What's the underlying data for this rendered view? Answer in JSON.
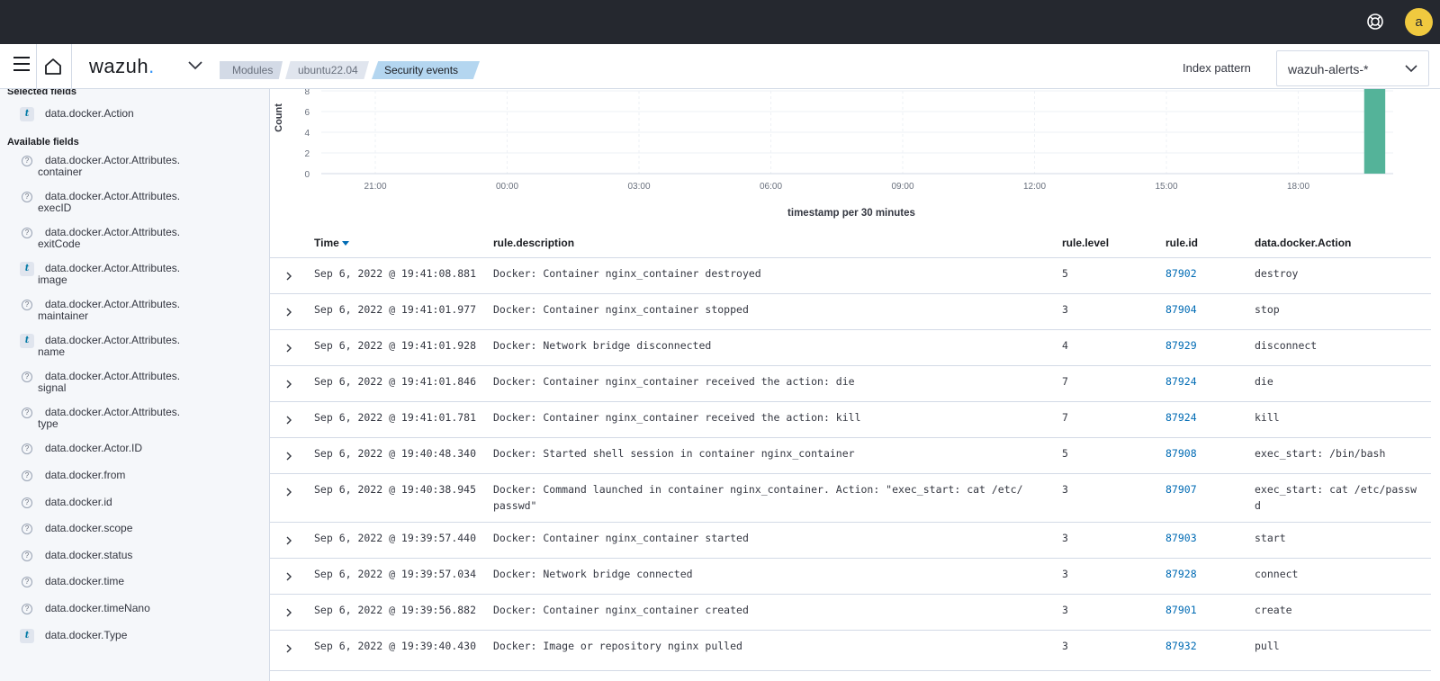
{
  "topbar": {
    "avatar_initial": "a"
  },
  "navbar": {
    "logo_text": "wazuh",
    "logo_dot": ".",
    "breadcrumbs": [
      "Modules",
      "ubuntu22.04",
      "Security events"
    ],
    "info_glyph": "i",
    "index_pattern_label": "Index pattern",
    "index_pattern_value": "wazuh-alerts-*"
  },
  "sidebar": {
    "selected_heading": "Selected fields",
    "selected_fields": [
      {
        "type": "t",
        "name": "data.docker.Action"
      }
    ],
    "available_heading": "Available fields",
    "available_fields": [
      {
        "type": "?",
        "name": "data.docker.Actor.Attributes.",
        "name2": "container"
      },
      {
        "type": "?",
        "name": "data.docker.Actor.Attributes.",
        "name2": "execID"
      },
      {
        "type": "?",
        "name": "data.docker.Actor.Attributes.",
        "name2": "exitCode"
      },
      {
        "type": "t",
        "name": "data.docker.Actor.Attributes.",
        "name2": "image"
      },
      {
        "type": "?",
        "name": "data.docker.Actor.Attributes.",
        "name2": "maintainer"
      },
      {
        "type": "t",
        "name": "data.docker.Actor.Attributes.",
        "name2": "name"
      },
      {
        "type": "?",
        "name": "data.docker.Actor.Attributes.",
        "name2": "signal"
      },
      {
        "type": "?",
        "name": "data.docker.Actor.Attributes.",
        "name2": "type"
      },
      {
        "type": "?",
        "name": "data.docker.Actor.ID",
        "name2": ""
      },
      {
        "type": "?",
        "name": "data.docker.from",
        "name2": ""
      },
      {
        "type": "?",
        "name": "data.docker.id",
        "name2": ""
      },
      {
        "type": "?",
        "name": "data.docker.scope",
        "name2": ""
      },
      {
        "type": "?",
        "name": "data.docker.status",
        "name2": ""
      },
      {
        "type": "?",
        "name": "data.docker.time",
        "name2": ""
      },
      {
        "type": "?",
        "name": "data.docker.timeNano",
        "name2": ""
      },
      {
        "type": "t",
        "name": "data.docker.Type",
        "name2": ""
      }
    ]
  },
  "chart_data": {
    "type": "bar",
    "ylabel": "Count",
    "xlabel": "timestamp per 30 minutes",
    "yticks": [
      "0",
      "2",
      "4",
      "6",
      "8"
    ],
    "ylim": [
      0,
      8
    ],
    "xticks": [
      "21:00",
      "00:00",
      "03:00",
      "06:00",
      "09:00",
      "12:00",
      "15:00",
      "18:00"
    ],
    "x_range": [
      "19:30",
      "20:00"
    ],
    "bars": [
      {
        "x": "19:30",
        "value": 11
      }
    ],
    "bar_color": "#54b399"
  },
  "table": {
    "columns": [
      "Time",
      "rule.description",
      "rule.level",
      "rule.id",
      "data.docker.Action"
    ],
    "rows": [
      {
        "time": "Sep 6, 2022 @ 19:41:08.881",
        "desc": "Docker: Container nginx_container destroyed",
        "desc2": "",
        "level": "5",
        "id": "87902",
        "action": "destroy",
        "action2": ""
      },
      {
        "time": "Sep 6, 2022 @ 19:41:01.977",
        "desc": "Docker: Container nginx_container stopped",
        "desc2": "",
        "level": "3",
        "id": "87904",
        "action": "stop",
        "action2": ""
      },
      {
        "time": "Sep 6, 2022 @ 19:41:01.928",
        "desc": "Docker: Network bridge disconnected",
        "desc2": "",
        "level": "4",
        "id": "87929",
        "action": "disconnect",
        "action2": ""
      },
      {
        "time": "Sep 6, 2022 @ 19:41:01.846",
        "desc": "Docker: Container nginx_container received the action: die",
        "desc2": "",
        "level": "7",
        "id": "87924",
        "action": "die",
        "action2": ""
      },
      {
        "time": "Sep 6, 2022 @ 19:41:01.781",
        "desc": "Docker: Container nginx_container received the action: kill",
        "desc2": "",
        "level": "7",
        "id": "87924",
        "action": "kill",
        "action2": ""
      },
      {
        "time": "Sep 6, 2022 @ 19:40:48.340",
        "desc": "Docker: Started shell session in container nginx_container",
        "desc2": "",
        "level": "5",
        "id": "87908",
        "action": "exec_start: /bin/bash",
        "action2": ""
      },
      {
        "time": "Sep 6, 2022 @ 19:40:38.945",
        "desc": "Docker: Command launched in container nginx_container. Action: \"exec_start: cat /etc/",
        "desc2": "passwd\"",
        "level": "3",
        "id": "87907",
        "action": "exec_start: cat /etc/passw",
        "action2": "d"
      },
      {
        "time": "Sep 6, 2022 @ 19:39:57.440",
        "desc": "Docker: Container nginx_container started",
        "desc2": "",
        "level": "3",
        "id": "87903",
        "action": "start",
        "action2": ""
      },
      {
        "time": "Sep 6, 2022 @ 19:39:57.034",
        "desc": "Docker: Network bridge connected",
        "desc2": "",
        "level": "3",
        "id": "87928",
        "action": "connect",
        "action2": ""
      },
      {
        "time": "Sep 6, 2022 @ 19:39:56.882",
        "desc": "Docker: Container nginx_container created",
        "desc2": "",
        "level": "3",
        "id": "87901",
        "action": "create",
        "action2": ""
      },
      {
        "time": "Sep 6, 2022 @ 19:39:40.430",
        "desc": "Docker: Image or repository nginx pulled",
        "desc2": "",
        "level": "3",
        "id": "87932",
        "action": "pull",
        "action2": ""
      }
    ]
  }
}
